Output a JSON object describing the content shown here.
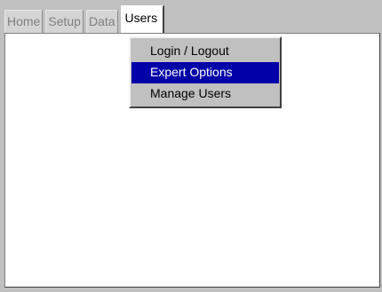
{
  "tabs": [
    {
      "label": "Home",
      "active": false
    },
    {
      "label": "Setup",
      "active": false
    },
    {
      "label": "Data",
      "active": false
    },
    {
      "label": "Users",
      "active": true
    }
  ],
  "menu": {
    "items": [
      {
        "label": "Login / Logout",
        "selected": false
      },
      {
        "label": "Expert Options",
        "selected": true
      },
      {
        "label": "Manage Users",
        "selected": false
      }
    ]
  },
  "colors": {
    "background": "#c0c0c0",
    "panel": "#ffffff",
    "selection": "#0000a8",
    "inactive_tab_text": "#808080"
  }
}
